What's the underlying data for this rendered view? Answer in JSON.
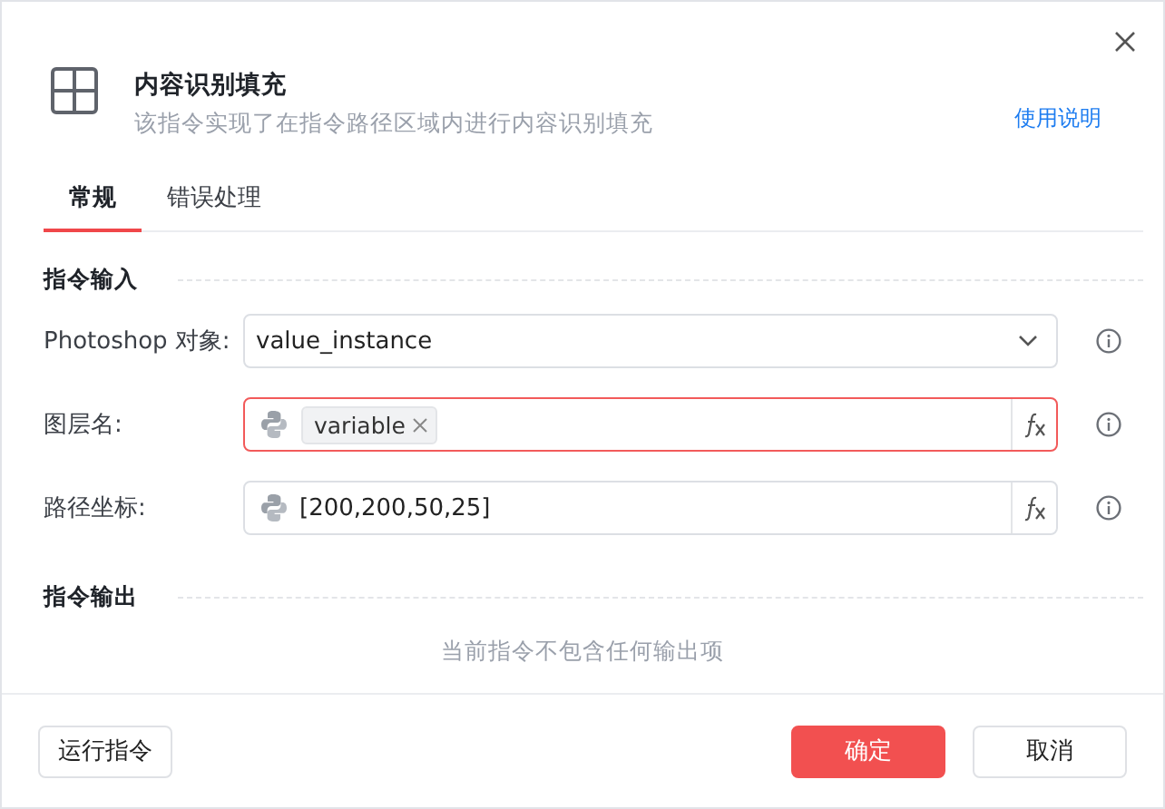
{
  "dialog": {
    "title": "内容识别填充",
    "subtitle": "该指令实现了在指令路径区域内进行内容识别填充",
    "help_link": "使用说明"
  },
  "tabs": [
    {
      "label": "常规",
      "selected": true
    },
    {
      "label": "错误处理",
      "selected": false
    }
  ],
  "input_section": {
    "title": "指令输入",
    "fields": [
      {
        "label": "Photoshop 对象:",
        "kind": "select",
        "value": "value_instance",
        "invalid": false
      },
      {
        "label": "图层名:",
        "kind": "tokens",
        "tokens": [
          "variable"
        ],
        "invalid": true
      },
      {
        "label": "路径坐标:",
        "kind": "expression",
        "value": "[200,200,50,25]",
        "invalid": false
      }
    ]
  },
  "output_section": {
    "title": "指令输出",
    "empty_text": "当前指令不包含任何输出项"
  },
  "buttons": [
    {
      "label": "运行指令",
      "kind": "secondary"
    },
    {
      "label": "确定",
      "kind": "primary"
    },
    {
      "label": "取消",
      "kind": "secondary"
    }
  ]
}
